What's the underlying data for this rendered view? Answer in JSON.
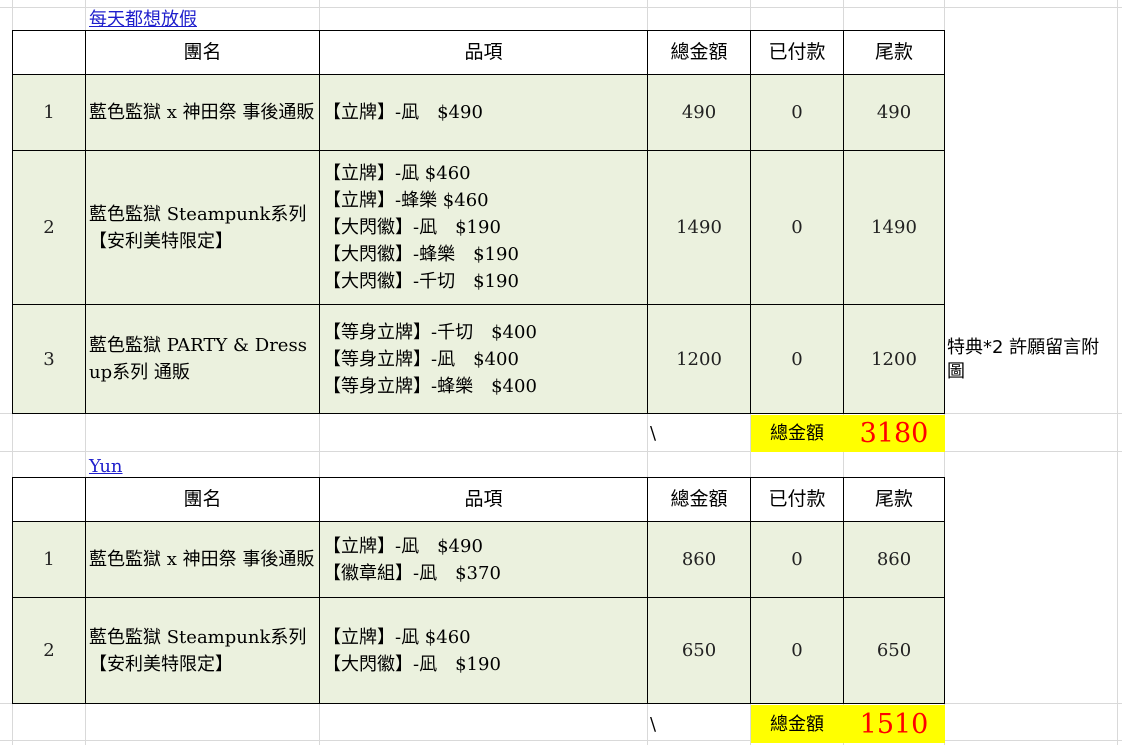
{
  "table1": {
    "title": "每天都想放假",
    "headers": [
      "團名",
      "品項",
      "總金額",
      "已付款",
      "尾款"
    ],
    "rows": [
      {
        "no": "1",
        "group": "藍色監獄 x 神田祭 事後通販",
        "items": [
          "【立牌】-凪　$490"
        ],
        "total": "490",
        "paid": "0",
        "balance": "490"
      },
      {
        "no": "2",
        "group": "藍色監獄 Steampunk系列【安利美特限定】",
        "items": [
          "【立牌】-凪 $460",
          "【立牌】-蜂樂 $460",
          "【大閃徽】-凪　$190",
          "【大閃徽】-蜂樂　$190",
          "【大閃徽】-千切　$190"
        ],
        "total": "1490",
        "paid": "0",
        "balance": "1490"
      },
      {
        "no": "3",
        "group": "藍色監獄 PARTY & Dress up系列 通販",
        "items": [
          "【等身立牌】-千切　$400",
          "【等身立牌】-凪　$400",
          "【等身立牌】-蜂樂　$400"
        ],
        "total": "1200",
        "paid": "0",
        "balance": "1200",
        "note": "特典*2 許願留言附圖"
      }
    ],
    "backslash": "\\",
    "total_label": "總金額",
    "total_value": "3180"
  },
  "table2": {
    "title": "Yun",
    "headers": [
      "團名",
      "品項",
      "總金額",
      "已付款",
      "尾款"
    ],
    "rows": [
      {
        "no": "1",
        "group": "藍色監獄 x 神田祭 事後通販",
        "items": [
          "【立牌】-凪　$490",
          "【徽章組】-凪　$370"
        ],
        "total": "860",
        "paid": "0",
        "balance": "860"
      },
      {
        "no": "2",
        "group": "藍色監獄 Steampunk系列【安利美特限定】",
        "items": [
          "【立牌】-凪 $460",
          "【大閃徽】-凪　$190"
        ],
        "total": "650",
        "paid": "0",
        "balance": "650"
      }
    ],
    "backslash": "\\",
    "total_label": "總金額",
    "total_value": "1510"
  }
}
